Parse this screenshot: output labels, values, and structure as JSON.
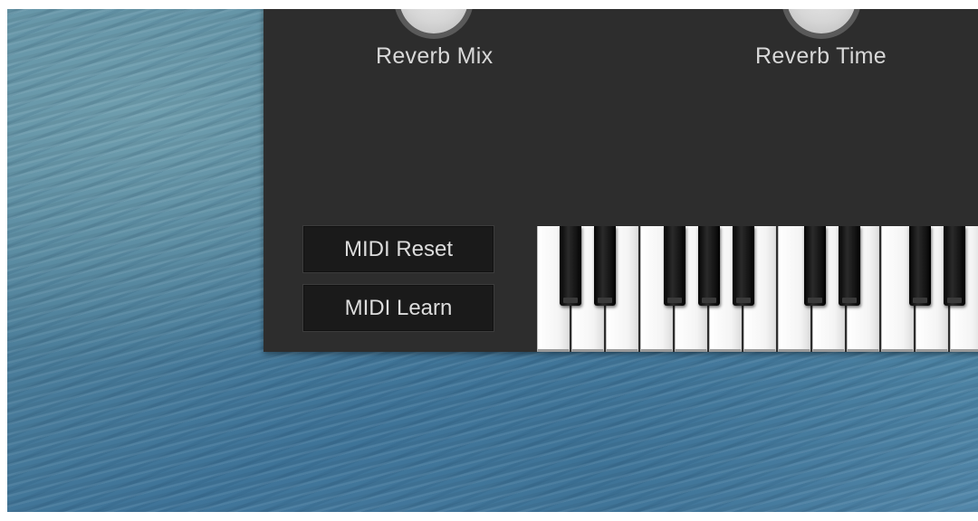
{
  "plugin": {
    "knobs": [
      {
        "label": "Reverb Mix"
      },
      {
        "label": "Reverb Time"
      }
    ],
    "buttons": {
      "midi_reset": "MIDI Reset",
      "midi_learn": "MIDI Learn"
    },
    "keyboard": {
      "visible_white_keys": 13,
      "visible_black_keys": 9
    }
  },
  "colors": {
    "panel_background": "#2d2d2d",
    "button_background": "#1a1a1a",
    "label_text": "#d8d8d8"
  }
}
